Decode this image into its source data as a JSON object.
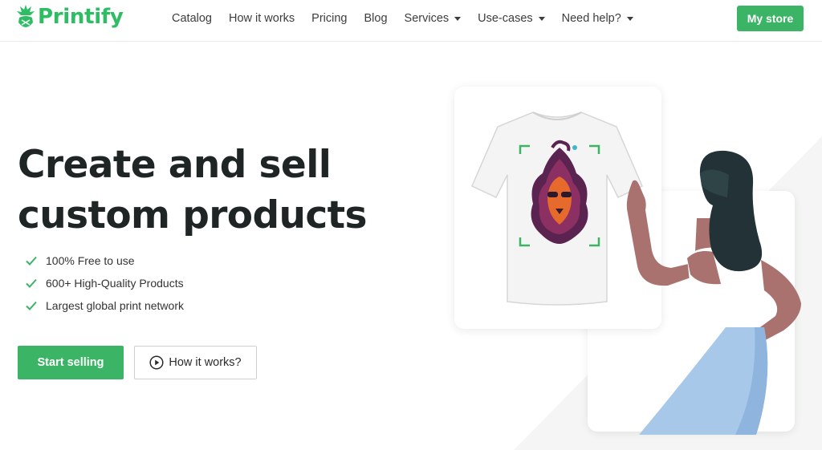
{
  "brand": {
    "name": "Printify",
    "color": "#2ebd63"
  },
  "nav": {
    "items": [
      {
        "label": "Catalog",
        "dropdown": false
      },
      {
        "label": "How it works",
        "dropdown": false
      },
      {
        "label": "Pricing",
        "dropdown": false
      },
      {
        "label": "Blog",
        "dropdown": false
      },
      {
        "label": "Services",
        "dropdown": true
      },
      {
        "label": "Use-cases",
        "dropdown": true
      },
      {
        "label": "Need help?",
        "dropdown": true
      }
    ],
    "store_button": "My store"
  },
  "hero": {
    "title_line1": "Create and sell",
    "title_line2": "custom products",
    "features": [
      "100% Free to use",
      "600+ High-Quality Products",
      "Largest global print network"
    ],
    "primary_cta": "Start selling",
    "secondary_cta": "How it works?"
  },
  "icons": {
    "logo": "pineapple-logo-icon",
    "check": "check-icon",
    "play": "play-circle-icon",
    "caret": "chevron-down-icon"
  },
  "colors": {
    "accent": "#3bb565",
    "heading": "#1e2524"
  }
}
